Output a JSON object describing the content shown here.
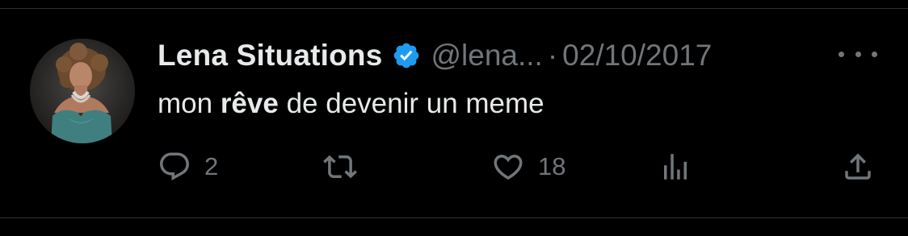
{
  "tweet": {
    "author_name": "Lena Situations",
    "handle": "@lena...",
    "separator": "·",
    "date": "02/10/2017",
    "text_before": "mon ",
    "text_bold": "rêve",
    "text_after": " de devenir un meme"
  },
  "actions": {
    "reply_count": "2",
    "like_count": "18"
  },
  "icons": {
    "verified": "verified-badge-icon",
    "more": "more-options-icon",
    "reply": "reply-icon",
    "retweet": "retweet-icon",
    "like": "heart-icon",
    "views": "views-icon",
    "share": "share-icon"
  },
  "colors": {
    "background": "#000000",
    "text_primary": "#e7e9ea",
    "text_secondary": "#71767b",
    "verified_blue": "#1d9bf0"
  }
}
